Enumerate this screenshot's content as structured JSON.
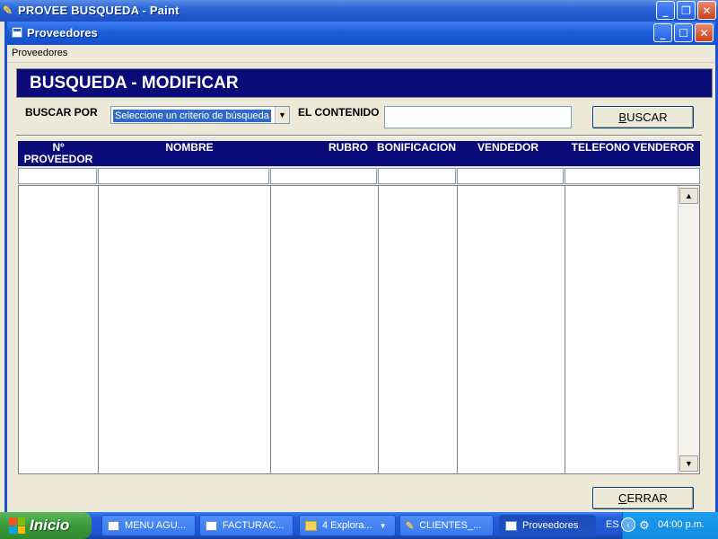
{
  "paint_window": {
    "title": "PROVEE BUSQUEDA - Paint"
  },
  "app_window": {
    "title": "Proveedores",
    "menu": [
      "Proveedores"
    ]
  },
  "form": {
    "header": "BUSQUEDA - MODIFICAR",
    "buscar_por_label": "BUSCAR POR",
    "criterio_selected": "Seleccione un criterio de búsqueda",
    "contenido_label": "EL CONTENIDO",
    "contenido_value": "",
    "buscar_button": "BUSCAR",
    "cerrar_button": "CERRAR"
  },
  "grid": {
    "columns": [
      {
        "label": "Nº PROVEEDOR"
      },
      {
        "label": "NOMBRE"
      },
      {
        "label": "RUBRO"
      },
      {
        "label": "BONIFICACION"
      },
      {
        "label": "VENDEDOR"
      },
      {
        "label": "TELEFONO VENDEROR"
      }
    ],
    "rows": []
  },
  "taskbar": {
    "start_label": "Inicio",
    "tasks": [
      {
        "label": "MENU AGU..."
      },
      {
        "label": "FACTURAC..."
      },
      {
        "label": "4 Explora..."
      },
      {
        "label": "CLIENTES_..."
      },
      {
        "label": "Proveedores"
      }
    ],
    "language": "ES",
    "clock": "04:00 p.m."
  },
  "colors": {
    "header_band": "#0a0a78",
    "xp_title_blue": "#1a5bd9",
    "start_green": "#3a9a3a"
  }
}
